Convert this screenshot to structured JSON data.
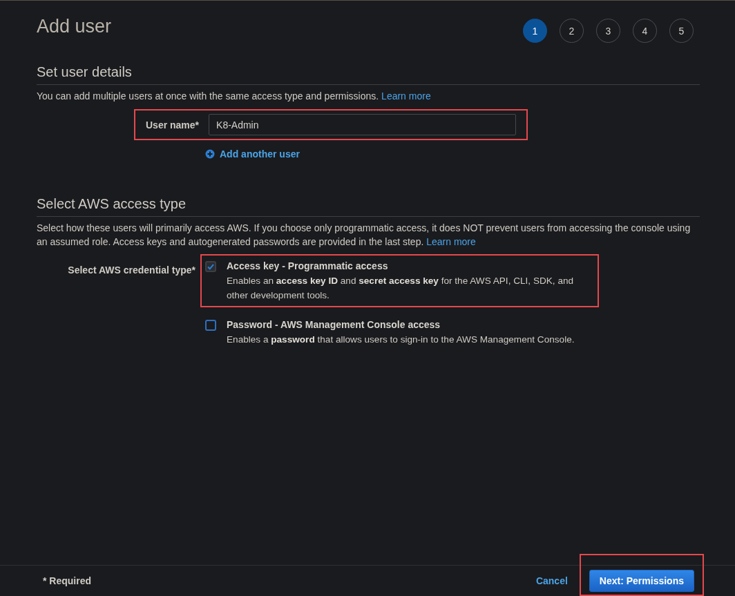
{
  "page": {
    "title": "Add user"
  },
  "steps": [
    {
      "label": "1",
      "selected": true
    },
    {
      "label": "2",
      "selected": false
    },
    {
      "label": "3",
      "selected": false
    },
    {
      "label": "4",
      "selected": false
    },
    {
      "label": "5",
      "selected": false
    }
  ],
  "details": {
    "heading": "Set user details",
    "intro": "You can add multiple users at once with the same access type and permissions.",
    "intro_link": "Learn more",
    "user_name": {
      "label": "User name*",
      "value": "K8-Admin",
      "highlighted": true
    },
    "add_another": "Add another user"
  },
  "access": {
    "heading": "Select AWS access type",
    "intro": "Select how these users will primarily access AWS. If you choose only programmatic access, it does NOT prevent users from accessing the console using an assumed role. Access keys and autogenerated passwords are provided in the last step.",
    "intro_link": "Learn more",
    "credential_label": "Select AWS credential type*",
    "options": [
      {
        "title": "Access key - Programmatic access",
        "description": "Enables an **access key ID** and **secret access key** for the AWS API, CLI, SDK, and other development tools.",
        "checked": true,
        "highlighted": true
      },
      {
        "title": "Password - AWS Management Console access",
        "description": "Enables a **password** that allows users to sign-in to the AWS Management Console.",
        "checked": false,
        "highlighted": false
      }
    ]
  },
  "footer": {
    "required_note": "* Required",
    "cancel": "Cancel",
    "next": {
      "label": "Next: Permissions",
      "highlighted": true
    }
  }
}
